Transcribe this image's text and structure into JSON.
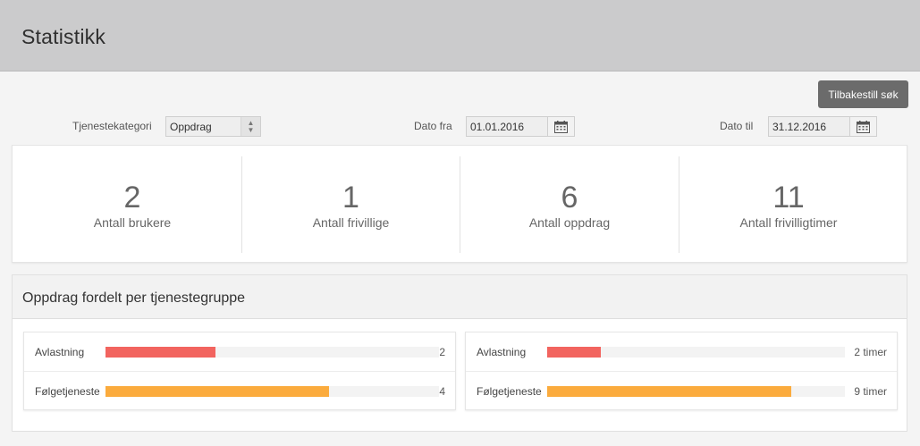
{
  "header": {
    "title": "Statistikk"
  },
  "toolbar": {
    "reset_label": "Tilbakestill søk"
  },
  "filters": {
    "category_label": "Tjenestekategori",
    "category_value": "Oppdrag",
    "date_from_label": "Dato fra",
    "date_from_value": "01.01.2016",
    "date_to_label": "Dato til",
    "date_to_value": "31.12.2016"
  },
  "stats": [
    {
      "value": "2",
      "label": "Antall brukere"
    },
    {
      "value": "1",
      "label": "Antall frivillige"
    },
    {
      "value": "6",
      "label": "Antall oppdrag"
    },
    {
      "value": "11",
      "label": "Antall frivilligtimer"
    }
  ],
  "group_panel": {
    "title": "Oppdrag fordelt per tjenestegruppe",
    "count_rows": [
      {
        "label": "Avlastning",
        "value": "2",
        "fraction": 0.33,
        "color": "#f2645f"
      },
      {
        "label": "Følgetjeneste",
        "value": "4",
        "fraction": 0.67,
        "color": "#fbab3d"
      }
    ],
    "hours_rows": [
      {
        "label": "Avlastning",
        "value": "2 timer",
        "fraction": 0.18,
        "color": "#f2645f"
      },
      {
        "label": "Følgetjeneste",
        "value": "9 timer",
        "fraction": 0.82,
        "color": "#fbab3d"
      }
    ]
  },
  "colors": {
    "header_bg": "#cbcbcc",
    "button_bg": "#6b6b6b",
    "bar_red": "#f2645f",
    "bar_orange": "#fbab3d"
  }
}
